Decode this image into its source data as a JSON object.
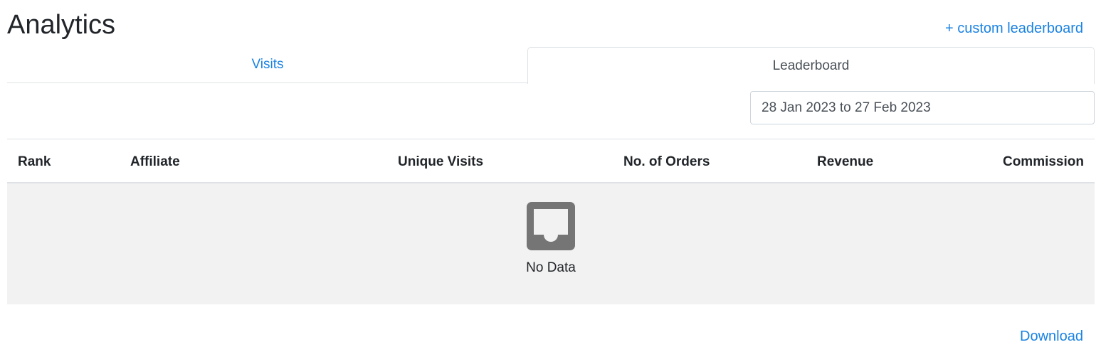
{
  "header": {
    "title": "Analytics",
    "custom_leaderboard_link": "+ custom leaderboard"
  },
  "tabs": [
    {
      "label": "Visits",
      "active": false
    },
    {
      "label": "Leaderboard",
      "active": true
    }
  ],
  "date_range": {
    "value": "28 Jan 2023 to 27 Feb 2023"
  },
  "table": {
    "columns": [
      "Rank",
      "Affiliate",
      "Unique Visits",
      "No. of Orders",
      "Revenue",
      "Commission"
    ],
    "rows": [],
    "empty_icon": "inbox-icon",
    "empty_text": "No Data"
  },
  "footer": {
    "download_label": "Download"
  },
  "colors": {
    "link": "#1a82e2",
    "empty_background": "#f2f2f2",
    "empty_icon": "#757575"
  }
}
